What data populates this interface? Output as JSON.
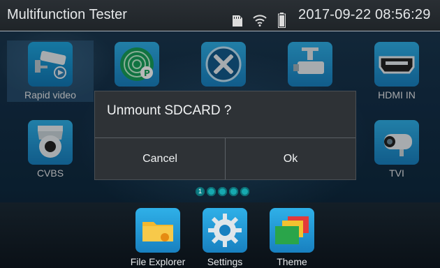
{
  "status_bar": {
    "title": "Multifunction Tester",
    "datetime": "2017-09-22 08:56:29",
    "icons": [
      "sdcard-icon",
      "wifi-icon",
      "battery-icon"
    ]
  },
  "grid": {
    "row1": [
      {
        "label": "Rapid video",
        "icon": "cctv-camera-icon",
        "selected": true
      },
      {
        "label": "",
        "icon": "ip-scan-icon"
      },
      {
        "label": "",
        "icon": "tools-icon"
      },
      {
        "label": "",
        "icon": "ptz-camera-icon"
      },
      {
        "label": "HDMI IN",
        "icon": "hdmi-icon"
      }
    ],
    "row2": [
      {
        "label": "CVBS",
        "icon": "dome-camera-icon"
      },
      {
        "label": "TVI",
        "icon": "bullet-camera-icon"
      }
    ]
  },
  "page_indicator": {
    "count": 5,
    "active_label": "1"
  },
  "dock": [
    {
      "label": "File Explorer",
      "icon": "folder-icon"
    },
    {
      "label": "Settings",
      "icon": "gear-icon"
    },
    {
      "label": "Theme",
      "icon": "theme-icon"
    }
  ],
  "dialog": {
    "title": "Unmount SDCARD ?",
    "cancel_label": "Cancel",
    "ok_label": "Ok"
  },
  "colors": {
    "accent": "#1e9ed6",
    "dialog_bg": "#2e3236"
  }
}
